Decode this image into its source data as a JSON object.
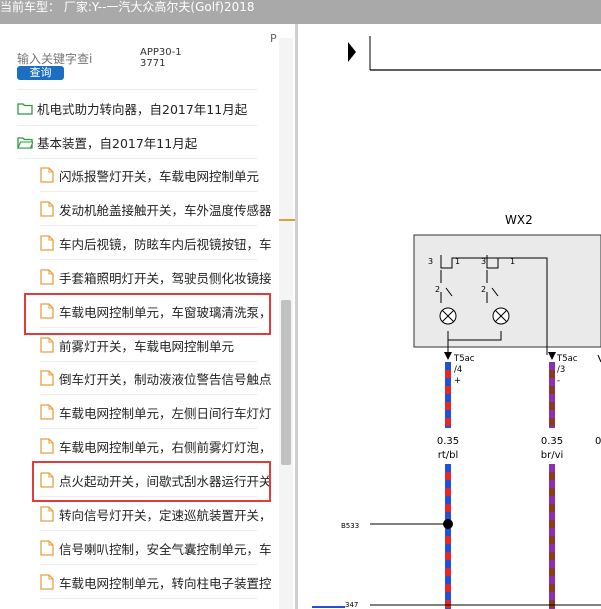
{
  "header": {
    "title": "当前车型：  厂家:Y--一汽大众高尔夫(Golf)2018"
  },
  "search": {
    "placeholder": "输入关键字查i",
    "button_label": "查询",
    "app_code": "APP30-13771"
  },
  "sidebar_marker": "P",
  "tree": {
    "folders": [
      {
        "label": "机电式助力转向器，自2017年11月起"
      },
      {
        "label": "基本装置，自2017年11月起"
      }
    ],
    "items": [
      {
        "label": "闪烁报警灯开关，车载电网控制单元"
      },
      {
        "label": "发动机舱盖接触开关，车外温度传感器"
      },
      {
        "label": "车内后视镜，防眩车内后视镜按钮，车"
      },
      {
        "label": "手套箱照明灯开关，驾驶员侧化妆镜接"
      },
      {
        "label": "车载电网控制单元，车窗玻璃清洗泵，",
        "highlighted": true
      },
      {
        "label": "前雾灯开关，车载电网控制单元"
      },
      {
        "label": "倒车灯开关，制动液液位警告信号触点"
      },
      {
        "label": "车载电网控制单元，左侧日间行车灯灯"
      },
      {
        "label": "车载电网控制单元，右侧前雾灯灯泡，"
      },
      {
        "label": "点火起动开关，间歇式刮水器运行开关",
        "highlighted": true
      },
      {
        "label": "转向信号灯开关，定速巡航装置开关，"
      },
      {
        "label": "信号喇叭控制，安全气囊控制单元，车"
      },
      {
        "label": "车载电网控制单元，转向柱电子装置控"
      }
    ]
  },
  "diagram": {
    "component": "WX2",
    "pin_labels": [
      "3",
      "1",
      "3",
      "1",
      "2",
      "2"
    ],
    "connector_left": {
      "name": "T5ac",
      "pin": "/4",
      "sign": "+"
    },
    "connector_right": {
      "name": "T5ac",
      "pin": "/3",
      "sign": "-"
    },
    "wire_left": {
      "size": "0.35",
      "color": "rt/bl"
    },
    "wire_right": {
      "size": "0.35",
      "color": "br/vi"
    },
    "wire_edge_size": "0",
    "node_left": "B533",
    "bottom_number": "347",
    "colors": {
      "red": "#e0282a",
      "blue": "#2250d8",
      "brown": "#8a3b22",
      "violet": "#8b2fb5"
    }
  }
}
